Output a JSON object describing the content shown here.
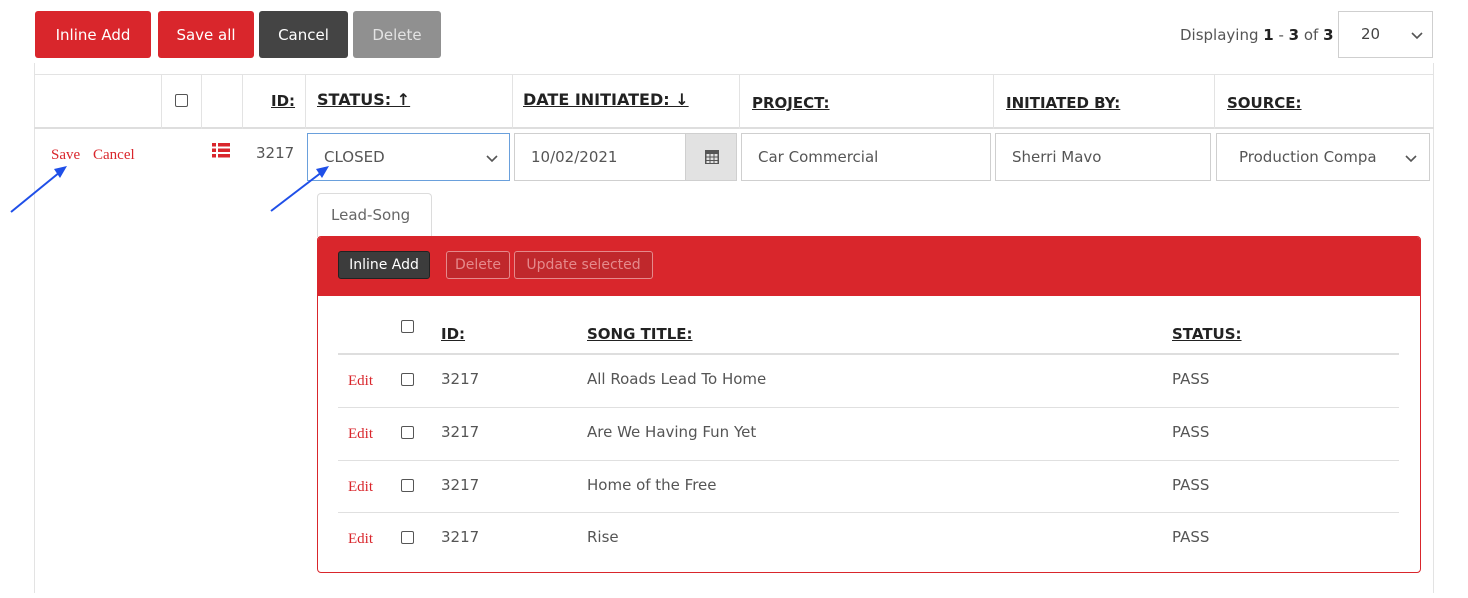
{
  "toolbar": {
    "inline_add": "Inline Add",
    "save_all": "Save all",
    "cancel": "Cancel",
    "delete": "Delete"
  },
  "pager": {
    "prefix": "Displaying ",
    "from": "1",
    "sep": " - ",
    "to": "3",
    "of": " of ",
    "total": "3",
    "page_size": "20"
  },
  "grid": {
    "headers": {
      "id": "ID:",
      "status": "STATUS: ↑",
      "date_initiated": "DATE INITIATED: ↓",
      "project": "PROJECT:",
      "initiated_by": "INITIATED BY:",
      "source": "SOURCE:"
    },
    "edit_row": {
      "save": "Save",
      "cancel": "Cancel",
      "id": "3217",
      "status": "CLOSED",
      "date": "10/02/2021",
      "project": "Car Commercial",
      "initiated_by": "Sherri Mavo",
      "source": "Production Compa"
    }
  },
  "detail": {
    "tab": "Lead-Song",
    "toolbar": {
      "inline_add": "Inline Add",
      "delete": "Delete",
      "update_selected": "Update selected"
    },
    "headers": {
      "id": "ID:",
      "song_title": "SONG TITLE:",
      "status": "STATUS:"
    },
    "rows": [
      {
        "edit": "Edit",
        "id": "3217",
        "title": "All Roads Lead To Home",
        "status": "PASS"
      },
      {
        "edit": "Edit",
        "id": "3217",
        "title": "Are We Having Fun Yet",
        "status": "PASS"
      },
      {
        "edit": "Edit",
        "id": "3217",
        "title": "Home of the Free",
        "status": "PASS"
      },
      {
        "edit": "Edit",
        "id": "3217",
        "title": "Rise",
        "status": "PASS"
      }
    ]
  },
  "colors": {
    "accent": "#d9262c",
    "dark_button": "#444444",
    "disabled_button": "#909090",
    "annotation_arrow": "#1f4fe8"
  },
  "icons": [
    "list-icon",
    "calendar-icon",
    "chevron-down-icon",
    "arrow-annotation-icon"
  ]
}
